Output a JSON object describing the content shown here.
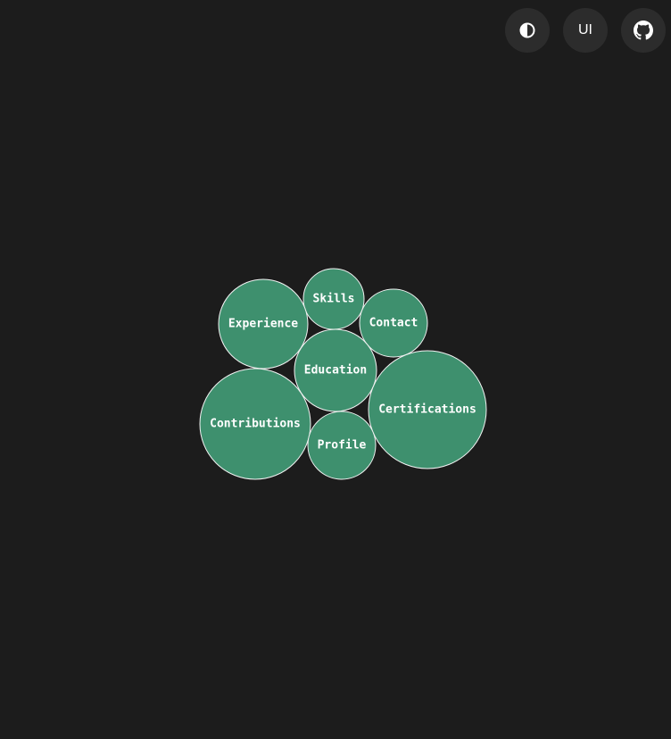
{
  "toolbar": {
    "theme_icon": "contrast-icon",
    "ui_label": "UI",
    "github_icon": "github-icon"
  },
  "colors": {
    "background": "#1c1c1c",
    "button_bg": "#2c2c2c",
    "bubble_fill": "#3e906e",
    "bubble_stroke": "#f2f2f2",
    "text": "#ffffff"
  },
  "bubbles": [
    {
      "label": "Skills",
      "key": "skills"
    },
    {
      "label": "Experience",
      "key": "experience"
    },
    {
      "label": "Contact",
      "key": "contact"
    },
    {
      "label": "Education",
      "key": "education"
    },
    {
      "label": "Certifications",
      "key": "certifications"
    },
    {
      "label": "Contributions",
      "key": "contributions"
    },
    {
      "label": "Profile",
      "key": "profile"
    }
  ]
}
